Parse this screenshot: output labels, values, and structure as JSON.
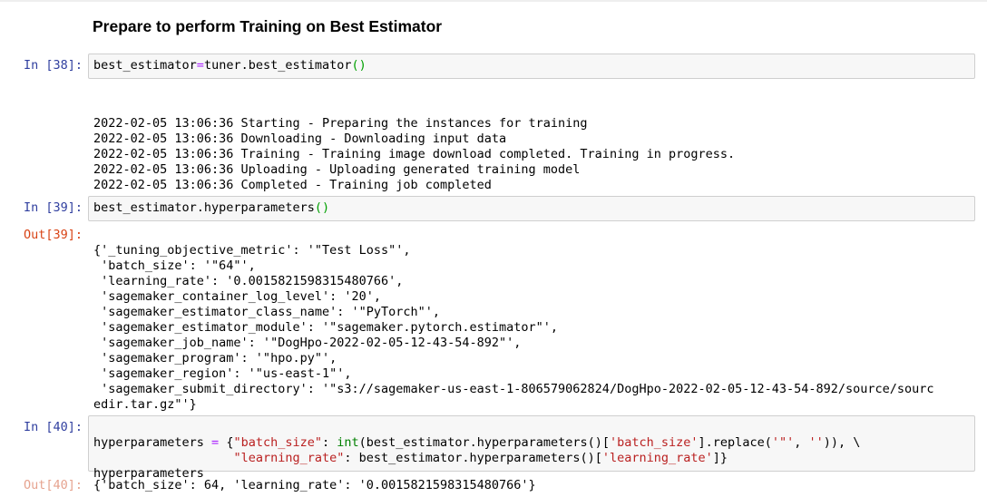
{
  "heading": "Prepare to perform Training on Best Estimator",
  "cells": [
    {
      "in_prompt": "In [38]:",
      "code": {
        "var": "best_estimator",
        "op": "=",
        "rhs": "tuner.best_estimator",
        "call": "()"
      },
      "stream": [
        "2022-02-05 13:06:36 Starting - Preparing the instances for training",
        "2022-02-05 13:06:36 Downloading - Downloading input data",
        "2022-02-05 13:06:36 Training - Training image download completed. Training in progress.",
        "2022-02-05 13:06:36 Uploading - Uploading generated training model",
        "2022-02-05 13:06:36 Completed - Training job completed"
      ]
    },
    {
      "in_prompt": "In [39]:",
      "out_prompt": "Out[39]:",
      "code": {
        "expr": "best_estimator.hyperparameters",
        "call": "()"
      },
      "output": [
        "{'_tuning_objective_metric': '\"Test Loss\"',",
        " 'batch_size': '\"64\"',",
        " 'learning_rate': '0.0015821598315480766',",
        " 'sagemaker_container_log_level': '20',",
        " 'sagemaker_estimator_class_name': '\"PyTorch\"',",
        " 'sagemaker_estimator_module': '\"sagemaker.pytorch.estimator\"',",
        " 'sagemaker_job_name': '\"DogHpo-2022-02-05-12-43-54-892\"',",
        " 'sagemaker_program': '\"hpo.py\"',",
        " 'sagemaker_region': '\"us-east-1\"',",
        " 'sagemaker_submit_directory': '\"s3://sagemaker-us-east-1-806579062824/DogHpo-2022-02-05-12-43-54-892/source/sourc",
        "edir.tar.gz\"'}"
      ]
    },
    {
      "in_prompt": "In [40]:",
      "out_prompt": "Out[40]:",
      "code": {
        "l1_var": "hyperparameters",
        "l1_op": " = ",
        "l1_open": "{",
        "l1_key": "\"batch_size\"",
        "l1_colon": ": ",
        "l1_int": "int",
        "l1_mid": "(best_estimator.hyperparameters()[",
        "l1_sub": "'batch_size'",
        "l1_replace": "].replace(",
        "l1_a1": "'\"'",
        "l1_comma": ", ",
        "l1_a2": "''",
        "l1_end": ")), \\",
        "l2_indent": "                   ",
        "l2_key": "\"learning_rate\"",
        "l2_mid": ": best_estimator.hyperparameters()[",
        "l2_sub": "'learning_rate'",
        "l2_end": "]}",
        "l3": "hyperparameters"
      },
      "output": "{'batch_size': 64, 'learning_rate': '0.0015821598315480766'}"
    }
  ]
}
